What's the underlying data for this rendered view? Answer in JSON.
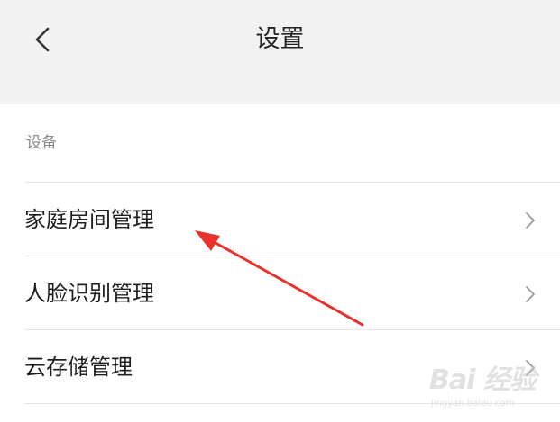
{
  "header": {
    "title": "设置",
    "back_icon": "chevron-left-icon"
  },
  "section": {
    "label": "设备"
  },
  "items": [
    {
      "label": "家庭房间管理",
      "icon": "chevron-right-icon"
    },
    {
      "label": "人脸识别管理",
      "icon": "chevron-right-icon"
    },
    {
      "label": "云存储管理",
      "icon": "chevron-right-icon"
    }
  ],
  "annotation": {
    "color": "#e8322b"
  },
  "watermark": {
    "brand": "Bai 经验",
    "url": "jingyan.baidu.com"
  },
  "colors": {
    "header_bg": "#f2f2f2",
    "divider": "#e6e6e6",
    "section_label": "#8a8a8a"
  }
}
